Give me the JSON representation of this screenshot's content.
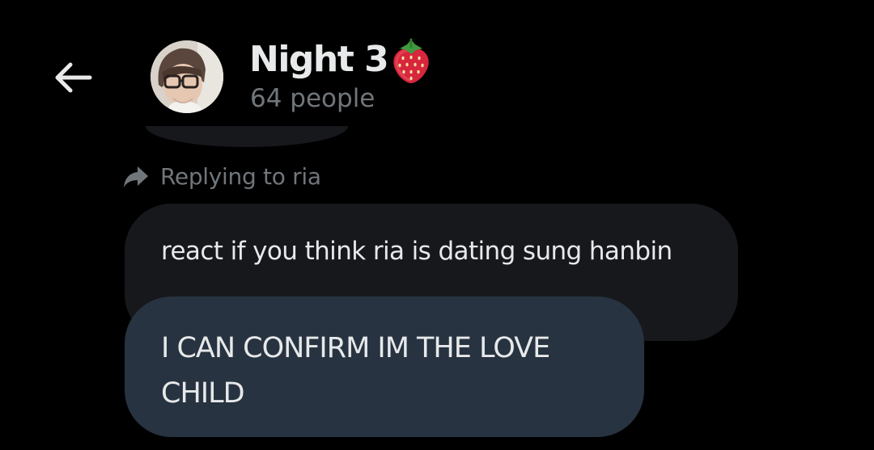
{
  "header": {
    "back_icon": "arrow-left-icon",
    "avatar_icon": "group-avatar",
    "title": "Night 3",
    "title_emoji_icon": "strawberry-icon",
    "subtitle": "64 people"
  },
  "conversation": {
    "reply_icon": "reply-arrow-icon",
    "replying_to_label": "Replying to ria",
    "quoted_message": "react if you think ria is dating sung hanbin",
    "message": "I CAN CONFIRM IM THE LOVE CHILD"
  },
  "colors": {
    "background": "#000000",
    "primary_text": "#e7e9ea",
    "secondary_text": "#71767b",
    "quoted_bubble": "#16181c",
    "message_bubble": "#273340"
  }
}
